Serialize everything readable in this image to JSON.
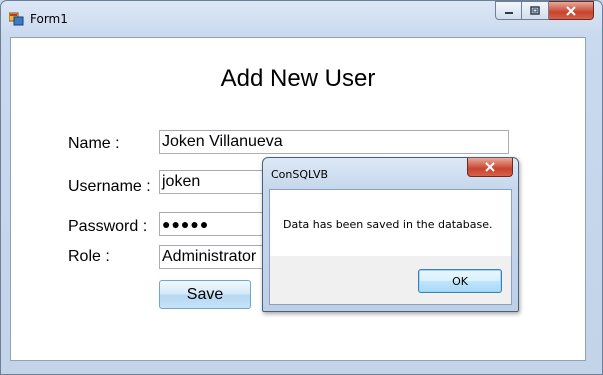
{
  "window": {
    "title": "Form1"
  },
  "form": {
    "heading": "Add New User",
    "fields": [
      {
        "label": "Name :",
        "value": "Joken Villanueva"
      },
      {
        "label": "Username :",
        "value": "joken"
      },
      {
        "label": "Password :",
        "value": "●●●●●"
      },
      {
        "label": "Role :",
        "value": "Administrator"
      }
    ],
    "save_label": "Save"
  },
  "dialog": {
    "title": "ConSQLVB",
    "message": "Data has been saved in the database.",
    "ok_label": "OK"
  },
  "colors": {
    "close_button": "#c7442e",
    "ok_border": "#3c7fb1"
  }
}
